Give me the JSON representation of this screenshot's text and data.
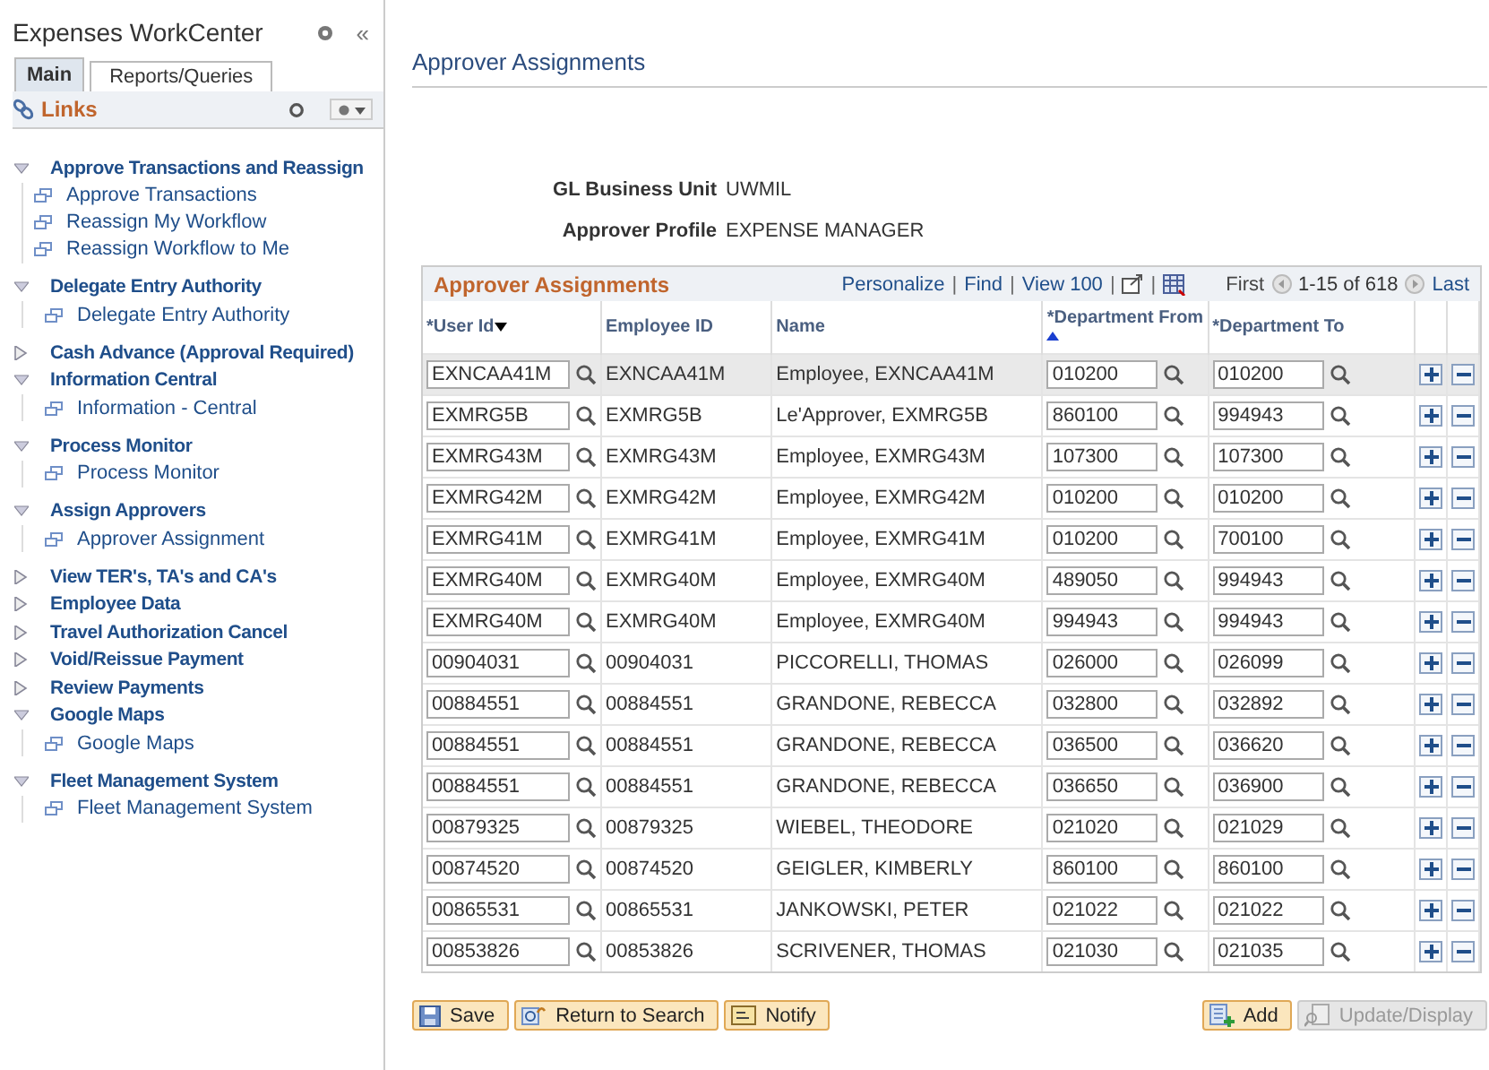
{
  "sidebar": {
    "title": "Expenses WorkCenter",
    "collapse": "«",
    "tabs": [
      {
        "label": "Main",
        "selected": true
      },
      {
        "label": "Reports/Queries",
        "selected": false
      }
    ],
    "links_title": "Links",
    "sections": [
      {
        "title": "Approve Transactions and Reassign",
        "expanded": true,
        "children": [
          "Approve Transactions",
          "Reassign My Workflow",
          "Reassign Workflow to Me"
        ]
      },
      {
        "title": "Delegate Entry Authority",
        "expanded": true,
        "children": [
          "Delegate Entry Authority"
        ]
      },
      {
        "title": "Cash Advance (Approval Required)",
        "expanded": false
      },
      {
        "title": "Information Central",
        "expanded": true,
        "children": [
          "Information - Central"
        ]
      },
      {
        "title": "Process Monitor",
        "expanded": true,
        "children": [
          "Process Monitor"
        ]
      },
      {
        "title": "Assign Approvers",
        "expanded": true,
        "children": [
          "Approver Assignment"
        ]
      },
      {
        "title": "View TER's, TA's and CA's",
        "expanded": false
      },
      {
        "title": "Employee Data",
        "expanded": false
      },
      {
        "title": "Travel Authorization Cancel",
        "expanded": false
      },
      {
        "title": "Void/Reissue Payment",
        "expanded": false
      },
      {
        "title": "Review Payments",
        "expanded": false
      },
      {
        "title": "Google Maps",
        "expanded": true,
        "children": [
          "Google Maps"
        ]
      },
      {
        "title": "Fleet Management System",
        "expanded": true,
        "children": [
          "Fleet Management System"
        ]
      }
    ]
  },
  "page_title": "Approver Assignments",
  "fields": [
    {
      "label": "GL Business Unit",
      "value": "UWMIL"
    },
    {
      "label": "Approver Profile",
      "value": "EXPENSE MANAGER"
    }
  ],
  "grid": {
    "title": "Approver Assignments",
    "links": [
      "Personalize",
      "Find",
      "View 100"
    ],
    "first": "First",
    "range": "1-15 of 618",
    "last": "Last",
    "separators": [
      "|",
      "|",
      "|",
      "|"
    ],
    "columns": [
      {
        "label": "*User Id",
        "sorted_asc": false,
        "sorted_desc": true
      },
      {
        "label": "Employee ID",
        "sorted_asc": false,
        "sorted_desc": false
      },
      {
        "label": "Name",
        "sorted_asc": false,
        "sorted_desc": false
      },
      {
        "label": "*Department From",
        "sorted_asc": true,
        "sorted_desc": false
      },
      {
        "label": "*Department To",
        "sorted_asc": false,
        "sorted_desc": false
      }
    ],
    "rows": [
      {
        "user_id": "EXNCAA41M",
        "employee_id": "EXNCAA41M",
        "name": "Employee, EXNCAA41M",
        "dept_from": "010200",
        "dept_to": "010200",
        "selected": true
      },
      {
        "user_id": "EXMRG5B",
        "employee_id": "EXMRG5B",
        "name": "Le'Approver, EXMRG5B",
        "dept_from": "860100",
        "dept_to": "994943",
        "selected": false
      },
      {
        "user_id": "EXMRG43M",
        "employee_id": "EXMRG43M",
        "name": "Employee, EXMRG43M",
        "dept_from": "107300",
        "dept_to": "107300",
        "selected": false
      },
      {
        "user_id": "EXMRG42M",
        "employee_id": "EXMRG42M",
        "name": "Employee, EXMRG42M",
        "dept_from": "010200",
        "dept_to": "010200",
        "selected": false
      },
      {
        "user_id": "EXMRG41M",
        "employee_id": "EXMRG41M",
        "name": "Employee, EXMRG41M",
        "dept_from": "010200",
        "dept_to": "700100",
        "selected": false
      },
      {
        "user_id": "EXMRG40M",
        "employee_id": "EXMRG40M",
        "name": "Employee, EXMRG40M",
        "dept_from": "489050",
        "dept_to": "994943",
        "selected": false
      },
      {
        "user_id": "EXMRG40M",
        "employee_id": "EXMRG40M",
        "name": "Employee, EXMRG40M",
        "dept_from": "994943",
        "dept_to": "994943",
        "selected": false
      },
      {
        "user_id": "00904031",
        "employee_id": "00904031",
        "name": "PICCORELLI, THOMAS",
        "dept_from": "026000",
        "dept_to": "026099",
        "selected": false
      },
      {
        "user_id": "00884551",
        "employee_id": "00884551",
        "name": "GRANDONE, REBECCA",
        "dept_from": "032800",
        "dept_to": "032892",
        "selected": false
      },
      {
        "user_id": "00884551",
        "employee_id": "00884551",
        "name": "GRANDONE, REBECCA",
        "dept_from": "036500",
        "dept_to": "036620",
        "selected": false
      },
      {
        "user_id": "00884551",
        "employee_id": "00884551",
        "name": "GRANDONE, REBECCA",
        "dept_from": "036650",
        "dept_to": "036900",
        "selected": false
      },
      {
        "user_id": "00879325",
        "employee_id": "00879325",
        "name": "WIEBEL, THEODORE",
        "dept_from": "021020",
        "dept_to": "021029",
        "selected": false
      },
      {
        "user_id": "00874520",
        "employee_id": "00874520",
        "name": "GEIGLER, KIMBERLY",
        "dept_from": "860100",
        "dept_to": "860100",
        "selected": false
      },
      {
        "user_id": "00865531",
        "employee_id": "00865531",
        "name": "JANKOWSKI, PETER",
        "dept_from": "021022",
        "dept_to": "021022",
        "selected": false
      },
      {
        "user_id": "00853826",
        "employee_id": "00853826",
        "name": "SCRIVENER, THOMAS",
        "dept_from": "021030",
        "dept_to": "021035",
        "selected": false
      }
    ]
  },
  "buttons_left": [
    {
      "kind": "save",
      "label": "Save",
      "disabled": false
    },
    {
      "kind": "return",
      "label": "Return to Search",
      "disabled": false
    },
    {
      "kind": "notify",
      "label": "Notify",
      "disabled": false
    }
  ],
  "buttons_right": [
    {
      "kind": "add",
      "label": "Add",
      "disabled": false
    },
    {
      "kind": "update",
      "label": "Update/Display",
      "disabled": true
    }
  ]
}
